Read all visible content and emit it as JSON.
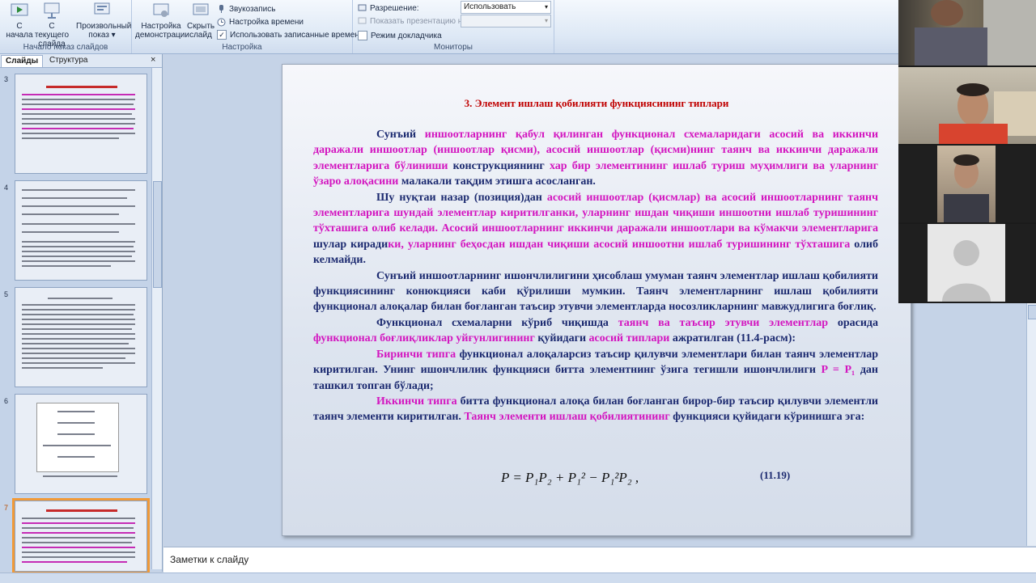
{
  "ribbon": {
    "group_start": {
      "title": "Начало показ слайдов",
      "from_start_1": "С",
      "from_start_2": "начала",
      "from_current_1": "С текущего",
      "from_current_2": "слайда",
      "custom_1": "Произвольный",
      "custom_2": "показ ▾"
    },
    "group_setup": {
      "title": "Настройка",
      "setup_1": "Настройка",
      "setup_2": "демонстрации",
      "hide_1": "Скрыть",
      "hide_2": "слайд",
      "record_narration": "Звукозапись",
      "rehearse_timings": "Настройка времени",
      "use_timings": "Использовать записанные времена"
    },
    "group_monitors": {
      "title": "Мониторы",
      "resolution_label": "Разрешение:",
      "resolution_value": "Использовать текуще...",
      "show_on_label": "Показать презентацию на:",
      "presenter_view": "Режим докладчика"
    }
  },
  "left_pane": {
    "tab_slides": "Слайды",
    "tab_outline": "Структура",
    "close": "×",
    "slide_numbers": [
      "3",
      "4",
      "5",
      "6",
      "7"
    ],
    "selected": "7"
  },
  "slide": {
    "title": "3. Элемент ишлаш қобилияти функциясининг типлари",
    "p1": [
      {
        "t": "Сунъий ",
        "m": false
      },
      {
        "t": "иншоотларнинг қабул қилинган функционал схемаларидаги асосий ва иккинчи даражали иншоотлар (иншоотлар қисми), асосий иншоотлар (қисми)нинг таянч ва иккинчи даражали элементларига бўлиниши",
        "m": true
      },
      {
        "t": " конструкциянинг ",
        "m": false
      },
      {
        "t": "хар бир элементининг ишлаб туриш муҳимлиги ва уларнинг ўзаро алоқасини",
        "m": true
      },
      {
        "t": " малакали тақдим этишга асосланган.",
        "m": false
      }
    ],
    "p2": [
      {
        "t": "Шу нуқтаи назар (позиция)дан ",
        "m": false
      },
      {
        "t": "асосий иншоотлар (қисмлар) ва асосий иншоотларнинг таянч элементларига шундай элементлар киритилганки, уларнинг ишдан чиқиши иншоотни ишлаб туришининг тўхташига олиб келади. Асосий иншоотларнинг иккинчи даражали иншоотлари ва кўмакчи элементларига",
        "m": true
      },
      {
        "t": " шулар киради",
        "m": false
      },
      {
        "t": "ки, уларнинг беҳосдан ишдан чиқиши асосий иншоотни ишлаб туришининг тўхташига",
        "m": true
      },
      {
        "t": " олиб келмайди.",
        "m": false
      }
    ],
    "p3": [
      {
        "t": "Сунъий иншоотларнинг ишончлилигини ҳисоблаш умуман таянч элементлар ишлаш қобилияти функциясининг конюкцияси каби қўрилиши мумкин. Таянч элементларнинг ишлаш қобилияти функционал алоқалар билан боғланган таъсир этувчи элементларда носозликларнинг мавжудлигига боғлиқ.",
        "m": false
      }
    ],
    "p4": [
      {
        "t": "Функционал схемаларни кўриб чиқишда ",
        "m": false
      },
      {
        "t": "таянч ва таъсир этувчи элементлар",
        "m": true
      },
      {
        "t": " орасида ",
        "m": false
      },
      {
        "t": "функционал боғлиқликлар уйғунлигининг",
        "m": true
      },
      {
        "t": " қуйидаги ",
        "m": false
      },
      {
        "t": "асосий типлари",
        "m": true
      },
      {
        "t": " ажратилган (11.4-расм):",
        "m": false
      }
    ],
    "p5": [
      {
        "t": "Биринчи типга",
        "m": true
      },
      {
        "t": " функционал алоқаларсиз таъсир қилувчи элементлари билан таянч элементлар киритилган. Унинг ишончлилик функцияси битта элементнинг ўзига тегишли ишончлилиги ",
        "m": false
      },
      {
        "t": "P = P₁",
        "m": true
      },
      {
        "t": " дан ташкил топган бўлади;",
        "m": false
      }
    ],
    "p6": [
      {
        "t": "Иккинчи типга",
        "m": true
      },
      {
        "t": " битта функционал алоқа билан боғланган бирор-бир таъсир қилувчи элементли таянч элементи киритилган. ",
        "m": false
      },
      {
        "t": "Таянч элементи ишлаш қобилиятининг",
        "m": true
      },
      {
        "t": " функцияси қуйидаги кўринишга эга:",
        "m": false
      }
    ],
    "formula": "P = P₁P₂ + P₁² − P₁²P₂ ,",
    "equation_number": "(11.19)"
  },
  "notes": {
    "placeholder": "Заметки к слайду"
  },
  "video_tiles": [
    "participant-1",
    "participant-2",
    "participant-3",
    "participant-4-avatar"
  ],
  "colors": {
    "body_text": "#1c2a70",
    "highlight": "#d316c0",
    "title": "#c00000",
    "selected_thumb": "#f19a38"
  }
}
